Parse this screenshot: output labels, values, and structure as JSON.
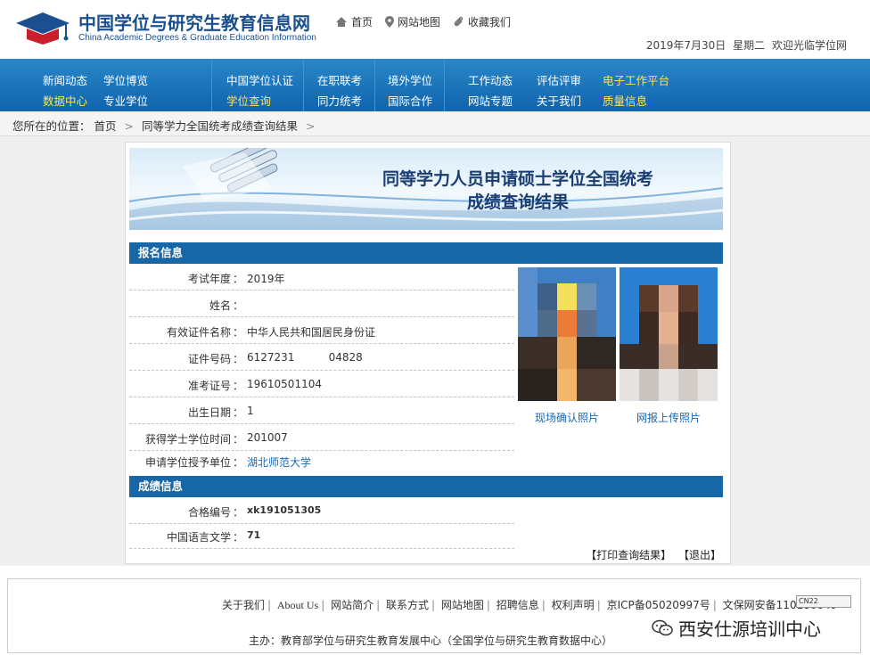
{
  "header": {
    "logo_cn": "中国学位与研究生教育信息网",
    "logo_en": "China Academic Degrees & Graduate Education Information",
    "toplinks": [
      "首页",
      "网站地图",
      "收藏我们"
    ],
    "date": "2019年7月30日",
    "weekday": "星期二",
    "welcome": "欢迎光临学位网"
  },
  "nav": {
    "groups": [
      {
        "items": [
          {
            "label": "新闻动态",
            "color": "white"
          },
          {
            "label": "学位博览",
            "color": "white"
          },
          {
            "label": "数据中心",
            "color": "yellow"
          },
          {
            "label": "专业学位",
            "color": "white"
          }
        ]
      },
      {
        "items": [
          {
            "label": "中国学位认证",
            "color": "white"
          },
          {
            "label": "学位查询",
            "color": "yellow"
          }
        ]
      },
      {
        "items": [
          {
            "label": "在职联考",
            "color": "white"
          },
          {
            "label": "同力统考",
            "color": "white"
          }
        ]
      },
      {
        "items": [
          {
            "label": "境外学位",
            "color": "white"
          },
          {
            "label": "国际合作",
            "color": "white"
          }
        ]
      },
      {
        "items": [
          {
            "label": "工作动态",
            "color": "white"
          },
          {
            "label": "评估评审",
            "color": "white"
          },
          {
            "label": "电子工作平台",
            "color": "yellow"
          },
          {
            "label": "网站专题",
            "color": "white"
          },
          {
            "label": "关于我们",
            "color": "white"
          },
          {
            "label": "质量信息",
            "color": "yellow"
          }
        ]
      }
    ]
  },
  "breadcrumb": {
    "prefix": "您所在的位置：",
    "home": "首页",
    "current": "同等学力全国统考成绩查询结果"
  },
  "banner": {
    "title_line1": "同等学力人员申请硕士学位全国统考",
    "title_line2": "成绩查询结果"
  },
  "sections": {
    "registration": "报名信息",
    "scores": "成绩信息"
  },
  "registration_rows": [
    {
      "label": "考试年度",
      "value": "2019年"
    },
    {
      "label": "姓名",
      "value": ""
    },
    {
      "label": "有效证件名称",
      "value": "中华人民共和国居民身份证"
    },
    {
      "label": "证件号码",
      "value": "6127231          04828"
    },
    {
      "label": "准考证号",
      "value": "19610501104"
    },
    {
      "label": "出生日期",
      "value": "1"
    },
    {
      "label": "获得学士学位时间",
      "value": "201007"
    },
    {
      "label": "申请学位授予单位",
      "value": "湖北师范大学"
    }
  ],
  "score_rows": [
    {
      "label": "合格编号",
      "value": "xk191051305"
    },
    {
      "label": "中国语言文学",
      "value": "71"
    }
  ],
  "colon": "：",
  "photos": {
    "onsite_caption": "现场确认照片",
    "online_caption": "网报上传照片"
  },
  "actions": {
    "print": "【打印查询结果】",
    "exit": "【退出】"
  },
  "footer": {
    "links": [
      "关于我们",
      "About Us",
      "网站简介",
      "联系方式",
      "网站地图",
      "招聘信息",
      "权利声明",
      "京ICP备05020997号",
      "文保网安备110180049"
    ],
    "badge": "CN22",
    "sponsor": "主办：教育部学位与研究生教育发展中心（全国学位与研究生教育数据中心）",
    "watermark": "西安仕源培训中心"
  },
  "colors": {
    "nav_blue": "#1766a8",
    "title_blue": "#1a3d74",
    "link_blue": "#1a66b0",
    "nav_yellow": "#ffe45c"
  }
}
